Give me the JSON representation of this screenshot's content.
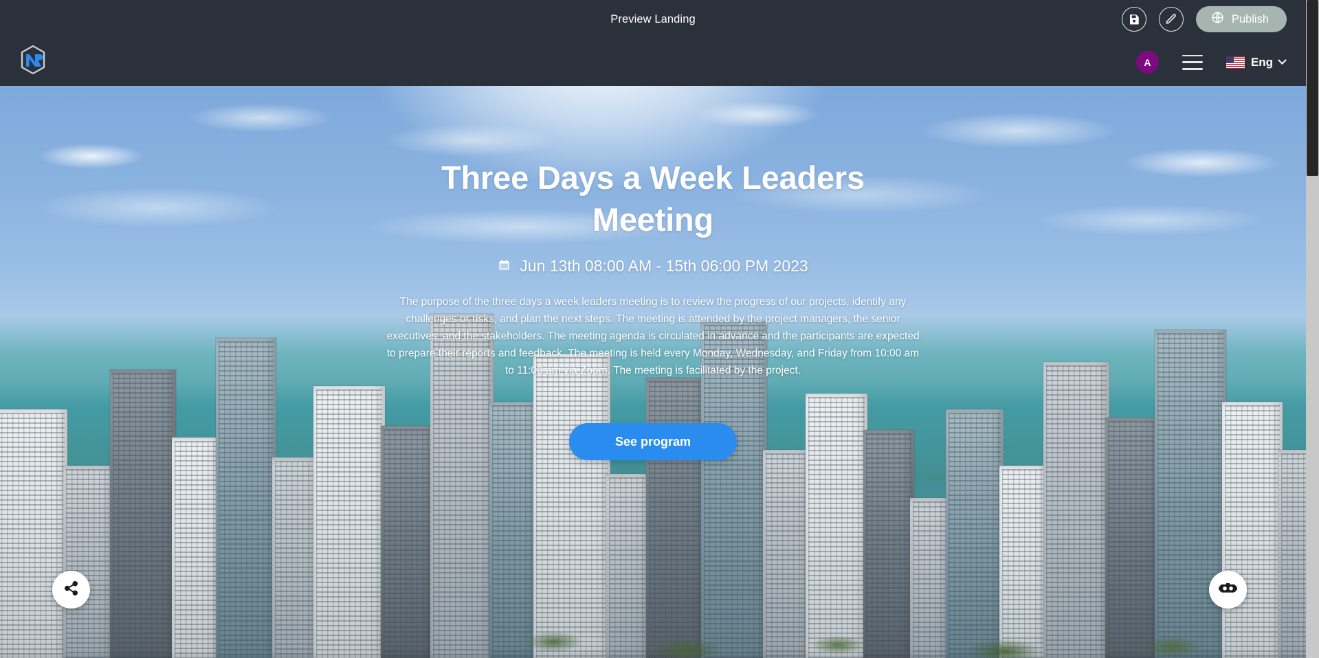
{
  "preview_bar": {
    "title": "Preview Landing",
    "save_icon": "save-floppy-icon",
    "edit_icon": "pencil-edit-icon",
    "publish_label": "Publish",
    "publish_icon": "globe-icon",
    "publish_color": "#a7b5b0"
  },
  "navbar": {
    "brand_logo": "nr-hexagon-logo",
    "avatar_initial": "A",
    "avatar_color": "#7b0b7e",
    "menu_icon": "hamburger-menu-icon",
    "language": {
      "flag": "us-flag-icon",
      "label": "Eng",
      "chevron": "chevron-down-icon"
    }
  },
  "hero": {
    "title": "Three Days a Week Leaders Meeting",
    "date_icon": "calendar-icon",
    "date": "Jun 13th 08:00 AM - 15th 06:00 PM 2023",
    "description": "The purpose of the three days a week leaders meeting is to review the progress of our projects, identify any challenges or risks, and plan the next steps. The meeting is attended by the project managers, the senior executives, and the stakeholders. The meeting agenda is circulated in advance and the participants are expected to prepare their reports and feedback. The meeting is held every Monday, Wednesday, and Friday from 10:00 am to 11:00 am via Zoom. The meeting is facilitated by the project.",
    "cta_label": "See program",
    "cta_color": "#2b8cf0",
    "share_fab_icon": "share-icon",
    "vr_fab_icon": "vr-headset-icon"
  }
}
